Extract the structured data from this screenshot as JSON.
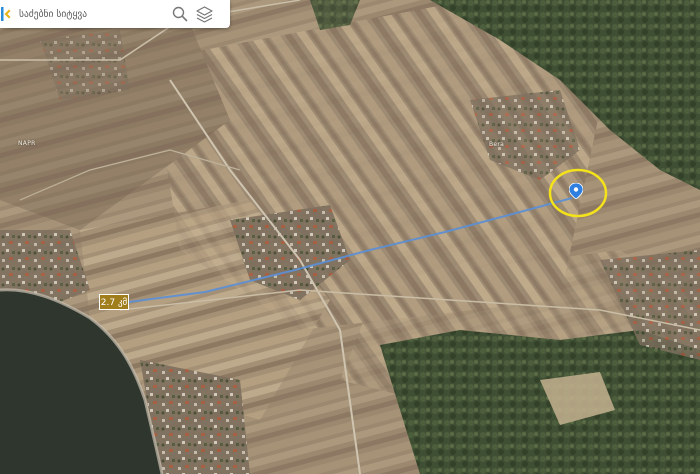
{
  "search": {
    "placeholder": "საძებნი სიტყვა"
  },
  "map": {
    "type": "satellite",
    "route_distance": "2.7 კმ",
    "place_labels": [
      "NAPR",
      "Bera"
    ],
    "route_color": "#5b8fd6",
    "highlight_color": "#f4e21a",
    "pin_color": "#2f7fe0"
  },
  "icons": {
    "logo": "logo-icon",
    "search": "search-icon",
    "layers": "layers-icon",
    "pin": "location-pin-icon"
  }
}
